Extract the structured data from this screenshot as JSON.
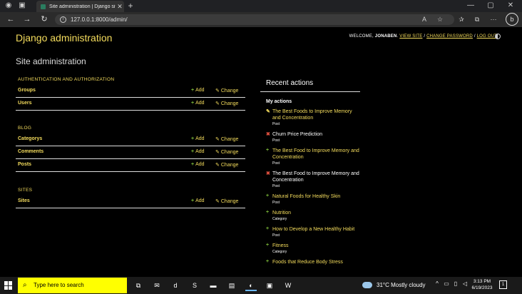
{
  "browser": {
    "tab_title": "Site administration | Django site",
    "url": "127.0.0.1:8000/admin/"
  },
  "header": {
    "brand": "Django administration",
    "welcome": "WELCOME,",
    "username": "JONABEN",
    "view_site": "VIEW SITE",
    "change_password": "CHANGE PASSWORD",
    "log_out": "LOG OUT",
    "separator": "/"
  },
  "page": {
    "title": "Site administration"
  },
  "modules": [
    {
      "caption": "AUTHENTICATION AND AUTHORIZATION",
      "rows": [
        {
          "name": "Groups",
          "add": "Add",
          "change": "Change"
        },
        {
          "name": "Users",
          "add": "Add",
          "change": "Change"
        }
      ]
    },
    {
      "caption": "BLOG",
      "rows": [
        {
          "name": "Categorys",
          "add": "Add",
          "change": "Change"
        },
        {
          "name": "Comments",
          "add": "Add",
          "change": "Change"
        },
        {
          "name": "Posts",
          "add": "Add",
          "change": "Change"
        }
      ]
    },
    {
      "caption": "SITES",
      "rows": [
        {
          "name": "Sites",
          "add": "Add",
          "change": "Change"
        }
      ]
    }
  ],
  "recent": {
    "heading": "Recent actions",
    "subheading": "My actions",
    "items": [
      {
        "title": "The Best Foods to Improve Memory and Concentration",
        "type": "Post",
        "action": "change"
      },
      {
        "title": "Churn Price Prediction",
        "type": "Post",
        "action": "delete"
      },
      {
        "title": "The Best Food to Improve Memory and Concentration",
        "type": "Post",
        "action": "add"
      },
      {
        "title": "The Best Food to Improve Memory and Concentration",
        "type": "Post",
        "action": "delete"
      },
      {
        "title": "Natural Foods for Healthy Skin",
        "type": "Post",
        "action": "add"
      },
      {
        "title": "Nutrition",
        "type": "Category",
        "action": "add"
      },
      {
        "title": "How to Develop a New Healthy Habit",
        "type": "Post",
        "action": "add"
      },
      {
        "title": "Fitness",
        "type": "Category",
        "action": "add"
      },
      {
        "title": "Foods that Reduce Body Stress",
        "type": "",
        "action": "add"
      }
    ]
  },
  "taskbar": {
    "search_placeholder": "Type here to search",
    "weather": "31°C  Mostly cloudy",
    "time": "3:13 PM",
    "date": "6/19/2023",
    "notification_count": "1"
  }
}
